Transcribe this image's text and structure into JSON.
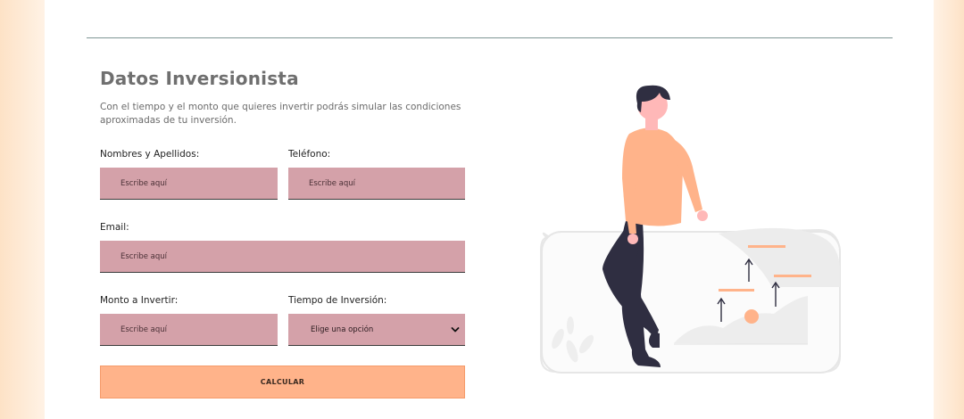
{
  "form": {
    "title": "Datos Inversionista",
    "description": "Con el tiempo y el monto que quieres invertir podrás simular las condiciones aproximadas de tu inversión.",
    "name_label": "Nombres y Apellidos:",
    "name_placeholder": "Escribe aquí",
    "phone_label": "Teléfono:",
    "phone_placeholder": "Escribe aquí",
    "email_label": "Email:",
    "email_placeholder": "Escribe aquí",
    "amount_label": "Monto a Invertir:",
    "amount_placeholder": "Escribe aquí",
    "term_label": "Tiempo de Inversión:",
    "term_selected": "Elige una opción",
    "submit_label": "CALCULAR"
  },
  "colors": {
    "input_bg": "#d4a1a9",
    "button_bg": "#ffb38a",
    "page_bg": "#fde9d3"
  },
  "icons": {
    "select_arrow": "chevron-down-icon",
    "illustration": "person-leaning-growth-chart-illustration"
  }
}
